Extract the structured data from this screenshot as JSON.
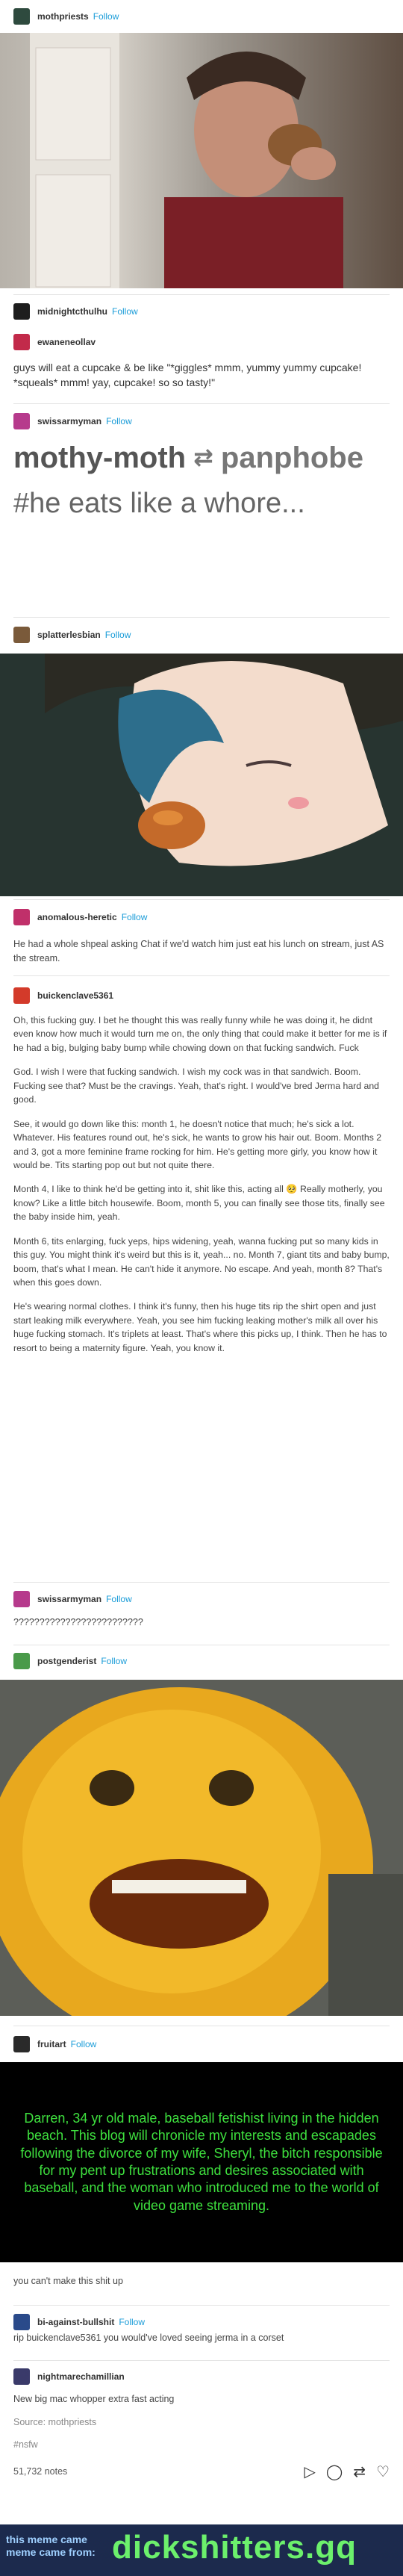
{
  "posts": {
    "p1": {
      "user": "mothpriests",
      "follow": "Follow"
    },
    "p2": {
      "user": "midnightcthulhu",
      "follow": "Follow"
    },
    "p3": {
      "user": "ewaneneollav",
      "text": "guys will eat a cupcake & be like \"*giggles* mmm, yummy yummy cupcake! *squeals* mmm! yay, cupcake! so so tasty!\""
    },
    "p4": {
      "user": "swissarmyman",
      "follow": "Follow",
      "title_left": "mothy-moth",
      "title_right": "panphobe",
      "hashtag": "#he eats like a whore..."
    },
    "p5": {
      "user": "splatterlesbian",
      "follow": "Follow"
    },
    "p6": {
      "user": "anomalous-heretic",
      "follow": "Follow",
      "text": "He had a whole shpeal asking Chat if we'd watch him just eat his lunch on stream, just AS the stream."
    },
    "p7": {
      "user": "buickenclave5361",
      "paragraphs": [
        "Oh, this fucking guy. I bet he thought this was really funny while he was doing it, he didnt even know how much it would turn me on, the only thing that could make it better for me is if he had a big, bulging baby bump while chowing down on that fucking sandwich. Fuck",
        "God. I wish I were that fucking sandwich. I wish my cock was in that sandwich. Boom. Fucking see that? Must be the cravings. Yeah, that's right. I would've bred Jerma hard and good.",
        "See, it would go down like this: month 1, he doesn't notice that much; he's sick a lot. Whatever. His features round out, he's sick, he wants to grow his hair out. Boom. Months 2 and 3, got a more feminine frame rocking for him. He's getting more girly, you know how it would be. Tits starting pop out but not quite there.",
        "Month 4, I like to think he'd be getting into it, shit like this, acting all 🥺 Really motherly, you know? Like a little bitch housewife. Boom, month 5, you can finally see those tits, finally see the baby inside him, yeah.",
        "Month 6, tits enlarging, fuck yeps, hips widening, yeah, wanna fucking put so many kids in this guy. You might think it's weird but this is it, yeah... no. Month 7, giant tits and baby bump, boom, that's what I mean. He can't hide it anymore. No escape. And yeah, month 8? That's when this goes down.",
        "He's wearing normal clothes. I think it's funny, then his huge tits rip the shirt open and just start leaking milk everywhere. Yeah, you see him fucking leaking mother's milk all over his huge fucking stomach. It's triplets at least. That's where this picks up, I think. Then he has to resort to being a maternity figure. Yeah, you know it."
      ]
    },
    "p8": {
      "user": "swissarmyman",
      "follow": "Follow",
      "text": "?????????????????????????"
    },
    "p9": {
      "user": "postgenderist",
      "follow": "Follow"
    },
    "p10": {
      "user": "fruitart",
      "follow": "Follow",
      "green_text": "Darren, 34 yr old male, baseball fetishist living in the hidden beach. This blog will chronicle my interests and escapades following the divorce of my wife, Sheryl, the bitch responsible for my pent up frustrations and desires associated with baseball, and the woman who introduced me to the world of video game streaming.",
      "caption": "you can't make this shit up"
    },
    "p11": {
      "user": "bi-against-bullshit",
      "follow": "Follow",
      "text": "rip buickenclave5361 you would've loved seeing jerma in a corset"
    },
    "p12": {
      "user": "nightmarechamillian",
      "text": "New big mac whopper extra fast acting",
      "source_label": "Source: mothpriests",
      "tag": "#nsfw",
      "notes": "51,732 notes"
    }
  },
  "banner": {
    "left_line1": "this meme came",
    "left_line2": "meme came from:",
    "right": "dickshitters.gq"
  },
  "colors": {
    "follow": "#1a9cd8",
    "green_text": "#3ee03e",
    "banner_bg": "#1c2a4d",
    "banner_text": "#6cf06c"
  }
}
